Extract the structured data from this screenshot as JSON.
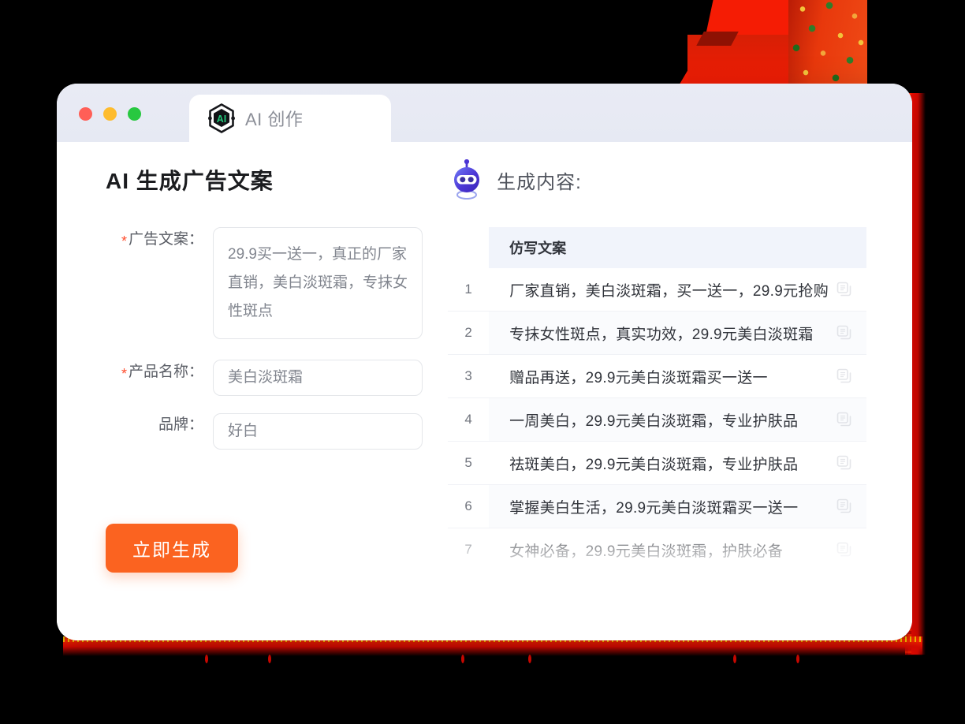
{
  "window": {
    "traffic_lights": [
      "close",
      "minimize",
      "zoom"
    ],
    "tab": {
      "label": "AI 创作",
      "icon": "ai-hexagon-icon"
    }
  },
  "left": {
    "title": "AI 生成广告文案",
    "fields": [
      {
        "label": "广告文案：",
        "required": true,
        "value": "29.9买一送一，真正的厂家直销，美白淡斑霜，专抹女性斑点",
        "type": "textarea"
      },
      {
        "label": "产品名称：",
        "required": true,
        "value": "美白淡斑霜",
        "type": "input"
      },
      {
        "label": "品牌：",
        "required": false,
        "value": "好白",
        "type": "input"
      }
    ],
    "submit_label": "立即生成"
  },
  "right": {
    "heading": "生成内容:",
    "robot_icon": "robot-icon",
    "table": {
      "column_header": "仿写文案",
      "rows": [
        {
          "no": "1",
          "text": "厂家直销，美白淡斑霜，买一送一，29.9元抢购"
        },
        {
          "no": "2",
          "text": "专抹女性斑点，真实功效，29.9元美白淡斑霜"
        },
        {
          "no": "3",
          "text": "赠品再送，29.9元美白淡斑霜买一送一"
        },
        {
          "no": "4",
          "text": "一周美白，29.9元美白淡斑霜，专业护肤品"
        },
        {
          "no": "5",
          "text": "祛斑美白，29.9元美白淡斑霜，专业护肤品"
        },
        {
          "no": "6",
          "text": "掌握美白生活，29.9元美白淡斑霜买一送一"
        },
        {
          "no": "7",
          "text": "女神必备，29.9元美白淡斑霜，护肤必备"
        }
      ],
      "row_action_icon": "copy-icon"
    }
  },
  "colors": {
    "accent_orange": "#fb6320",
    "required_star": "#ff4d2d",
    "titlebar": "#e8eaf3",
    "table_header_bg": "#f1f4fb",
    "decoration_red": "#f51c04",
    "ai_badge_green": "#22c67a",
    "robot_purple": "#4b35d4"
  }
}
